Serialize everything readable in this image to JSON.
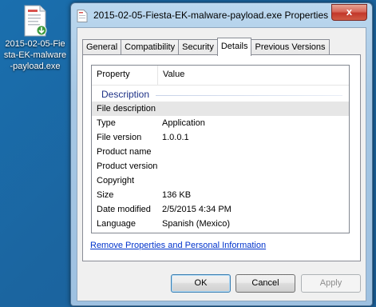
{
  "desktop": {
    "file_label": "2015-02-05-Fiesta-EK-malware-payload.exe"
  },
  "window": {
    "title": "2015-02-05-Fiesta-EK-malware-payload.exe Properties",
    "close_label": "x"
  },
  "tabs": [
    {
      "label": "General",
      "active": false
    },
    {
      "label": "Compatibility",
      "active": false
    },
    {
      "label": "Security",
      "active": false
    },
    {
      "label": "Details",
      "active": true
    },
    {
      "label": "Previous Versions",
      "active": false
    }
  ],
  "details": {
    "columns": {
      "property": "Property",
      "value": "Value"
    },
    "group": "Description",
    "rows": [
      {
        "property": "File description",
        "value": ""
      },
      {
        "property": "Type",
        "value": "Application"
      },
      {
        "property": "File version",
        "value": "1.0.0.1"
      },
      {
        "property": "Product name",
        "value": ""
      },
      {
        "property": "Product version",
        "value": ""
      },
      {
        "property": "Copyright",
        "value": ""
      },
      {
        "property": "Size",
        "value": "136 KB"
      },
      {
        "property": "Date modified",
        "value": "2/5/2015 4:34 PM"
      },
      {
        "property": "Language",
        "value": "Spanish (Mexico)"
      }
    ]
  },
  "links": {
    "remove_properties": "Remove Properties and Personal Information"
  },
  "buttons": {
    "ok": "OK",
    "cancel": "Cancel",
    "apply": "Apply"
  }
}
